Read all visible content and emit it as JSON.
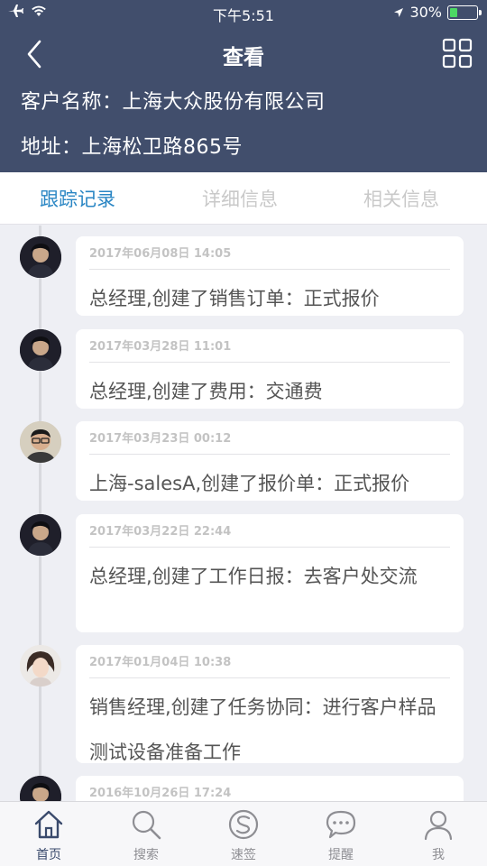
{
  "status_bar": {
    "time": "下午5:51",
    "battery_percent": "30%",
    "battery_level": 0.3
  },
  "nav": {
    "title": "查看",
    "back_icon": "chevron-left-icon",
    "grid_icon": "grid-icon"
  },
  "customer": {
    "name_line": "客户名称：上海大众股份有限公司",
    "address_line": "地址：上海松卫路865号"
  },
  "tabs": [
    {
      "label": "跟踪记录",
      "active": true
    },
    {
      "label": "详细信息",
      "active": false
    },
    {
      "label": "相关信息",
      "active": false
    }
  ],
  "entries": [
    {
      "date": "2017年06月08日 14:05",
      "text": "总经理,创建了销售订单：正式报价",
      "avatar": "male-a"
    },
    {
      "date": "2017年03月28日 11:01",
      "text": "总经理,创建了费用：交通费",
      "avatar": "male-a"
    },
    {
      "date": "2017年03月23日 00:12",
      "text": "上海-salesA,创建了报价单：正式报价",
      "avatar": "male-b"
    },
    {
      "date": "2017年03月22日 22:44",
      "text": "总经理,创建了工作日报：去客户处交流",
      "avatar": "male-a"
    },
    {
      "date": "2017年01月04日 10:38",
      "text": "销售经理,创建了任务协同：进行客户样品测试设备准备工作",
      "avatar": "female"
    },
    {
      "date": "2016年10月26日 17:24",
      "text": "",
      "avatar": "male-a"
    }
  ],
  "tabbar": [
    {
      "label": "首页",
      "icon": "home-icon",
      "active": true
    },
    {
      "label": "搜索",
      "icon": "search-icon",
      "active": false
    },
    {
      "label": "速签",
      "icon": "quick-sign-icon",
      "active": false
    },
    {
      "label": "提醒",
      "icon": "chat-bubble-icon",
      "active": false
    },
    {
      "label": "我",
      "icon": "person-icon",
      "active": false
    }
  ],
  "colors": {
    "header_bg": "#414e6c",
    "active_tab": "#2a86c4",
    "page_bg": "#eeeff4"
  }
}
